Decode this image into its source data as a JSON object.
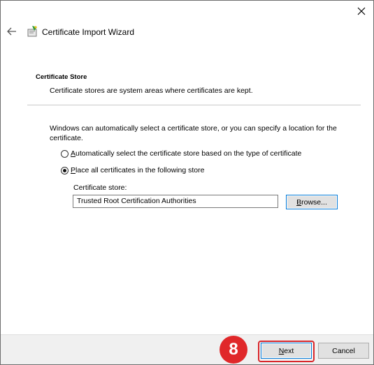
{
  "window": {
    "title": "Certificate Import Wizard",
    "close_icon": "close-icon",
    "back_icon": "back-arrow-icon",
    "app_icon": "certificate-wizard-icon"
  },
  "header": {
    "title": "Certificate Store",
    "description": "Certificate stores are system areas where certificates are kept."
  },
  "body": {
    "intro": "Windows can automatically select a certificate store, or you can specify a location for the certificate.",
    "options": [
      {
        "accel": "A",
        "rest": "utomatically select the certificate store based on the type of certificate",
        "selected": false
      },
      {
        "accel": "P",
        "rest": "lace all certificates in the following store",
        "selected": true
      }
    ],
    "store_label": "Certificate store:",
    "store_value": "Trusted Root Certification Authorities",
    "browse_accel": "B",
    "browse_rest": "rowse..."
  },
  "footer": {
    "step_number": "8",
    "next_accel": "N",
    "next_rest": "ext",
    "cancel_label": "Cancel",
    "highlight_color": "#d9262b"
  }
}
